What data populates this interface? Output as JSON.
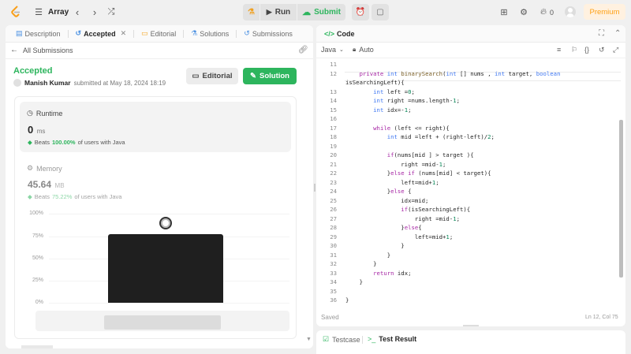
{
  "topbar": {
    "problem_list": "Array",
    "run": "Run",
    "submit": "Submit",
    "streak": "0",
    "premium": "Premium"
  },
  "left_tabs": [
    {
      "label": "Description"
    },
    {
      "label": "Accepted"
    },
    {
      "label": "Editorial"
    },
    {
      "label": "Solutions"
    },
    {
      "label": "Submissions"
    }
  ],
  "submission": {
    "back": "All Submissions",
    "status": "Accepted",
    "user": "Manish Kumar",
    "submitted": "submitted at May 18, 2024 18:19",
    "editorial_btn": "Editorial",
    "solution_btn": "Solution"
  },
  "runtime": {
    "label": "Runtime",
    "value": "0",
    "unit": "ms",
    "beats_prefix": "Beats",
    "beats": "100.00%",
    "beats_suffix": "of users with Java"
  },
  "memory": {
    "label": "Memory",
    "value": "45.64",
    "unit": "MB",
    "beats_prefix": "Beats",
    "beats": "75.22%",
    "beats_suffix": "of users with Java"
  },
  "chart": {
    "yticks": [
      "100%",
      "75%",
      "50%",
      "25%",
      "0%"
    ]
  },
  "chart_data": {
    "type": "bar",
    "yticks": [
      "100%",
      "75%",
      "50%",
      "25%",
      "0%"
    ],
    "ylim": [
      0,
      100
    ],
    "values": [
      77
    ]
  },
  "code_panel": {
    "title": "Code",
    "language": "Java",
    "mode": "Auto",
    "status": "Saved",
    "cursor": "Ln 12, Col 75"
  },
  "code_lines": [
    {
      "n": "11",
      "t": ""
    },
    {
      "n": "12",
      "t": "    private int binarySearch(int [] nums , int target, boolean"
    },
    {
      "n": "",
      "t": "isSearchingLeft){"
    },
    {
      "n": "13",
      "t": "        int left =0;"
    },
    {
      "n": "14",
      "t": "        int right =nums.length-1;"
    },
    {
      "n": "15",
      "t": "        int idx=-1;"
    },
    {
      "n": "16",
      "t": ""
    },
    {
      "n": "17",
      "t": "        while (left <= right){"
    },
    {
      "n": "18",
      "t": "            int mid =left + (right-left)/2;"
    },
    {
      "n": "19",
      "t": ""
    },
    {
      "n": "20",
      "t": "            if(nums[mid ] > target ){"
    },
    {
      "n": "21",
      "t": "                right =mid-1;"
    },
    {
      "n": "22",
      "t": "            }else if (nums[mid] < target){"
    },
    {
      "n": "23",
      "t": "                left=mid+1;"
    },
    {
      "n": "24",
      "t": "            }else {"
    },
    {
      "n": "25",
      "t": "                idx=mid;"
    },
    {
      "n": "26",
      "t": "                if(isSearchingLeft){"
    },
    {
      "n": "27",
      "t": "                    right =mid-1;"
    },
    {
      "n": "28",
      "t": "                }else{"
    },
    {
      "n": "29",
      "t": "                    left=mid+1;"
    },
    {
      "n": "30",
      "t": "                }"
    },
    {
      "n": "31",
      "t": "            }"
    },
    {
      "n": "32",
      "t": "        }"
    },
    {
      "n": "33",
      "t": "        return idx;"
    },
    {
      "n": "34",
      "t": "    }"
    },
    {
      "n": "35",
      "t": ""
    },
    {
      "n": "36",
      "t": "}"
    }
  ],
  "bottom_tabs": [
    {
      "label": "Testcase"
    },
    {
      "label": "Test Result"
    }
  ]
}
